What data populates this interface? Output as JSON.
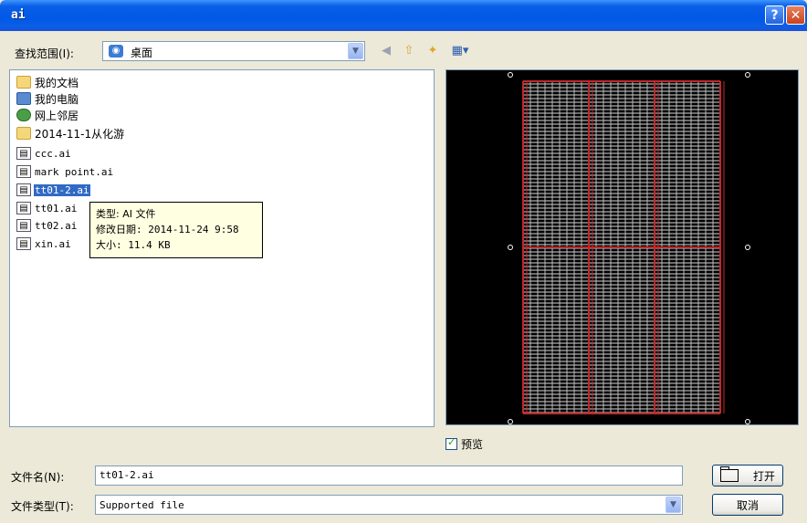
{
  "window": {
    "title": "ai",
    "help_glyph": "?",
    "close_glyph": "✕"
  },
  "toolbar": {
    "look_in_label": "查找范围(I):",
    "look_in_value": "桌面",
    "icons": [
      "back-icon",
      "up-folder-icon",
      "new-folder-icon",
      "view-menu-icon"
    ]
  },
  "files": [
    {
      "name": "我的文档",
      "icon": "folder"
    },
    {
      "name": "我的电脑",
      "icon": "computer"
    },
    {
      "name": "网上邻居",
      "icon": "network"
    },
    {
      "name": "2014-11-1从化游",
      "icon": "folder"
    },
    {
      "name": "ccc.ai",
      "icon": "ai-file"
    },
    {
      "name": "mark point.ai",
      "icon": "ai-file"
    },
    {
      "name": "tt01-2.ai",
      "icon": "ai-file",
      "selected": true
    },
    {
      "name": "tt01.ai",
      "icon": "ai-file"
    },
    {
      "name": "tt02.ai",
      "icon": "ai-file"
    },
    {
      "name": "xin.ai",
      "icon": "ai-file"
    }
  ],
  "tooltip": {
    "type": "类型: AI 文件",
    "modified": "修改日期: 2014-11-24 9:58",
    "size": "大小: 11.4 KB"
  },
  "preview": {
    "checkbox_label": "预览",
    "checked": true
  },
  "filename": {
    "label": "文件名(N):",
    "value": "tt01-2.ai"
  },
  "filetype": {
    "label": "文件类型(T):",
    "value": "Supported file"
  },
  "buttons": {
    "open": "打开",
    "cancel": "取消"
  },
  "colors": {
    "title_bar": "#0058E6",
    "selection": "#316AC5",
    "preview_bg": "#000000",
    "grid_line": "#C0282D"
  }
}
